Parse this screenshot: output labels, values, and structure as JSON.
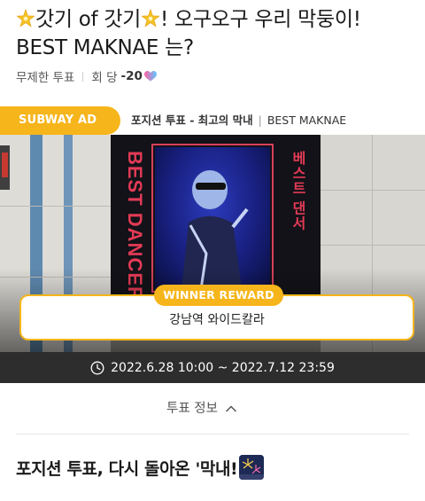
{
  "vote": {
    "title_part1": "갓기 of 갓기",
    "title_part2": "! 오구오구 우리 막둥이! BEST MAKNAE 는?",
    "title_icon": "sparkle-star-icon",
    "vote_type": "무제한 투표",
    "per_vote_label": "회 당",
    "per_vote_value": "-20",
    "heart_icon": "heart-icon"
  },
  "ad": {
    "badge": "SUBWAY AD",
    "caption_bold": "포지션 투표 - 최고의 막내",
    "caption_sep": "|",
    "caption_tail": "BEST MAKNAE",
    "billboard_text_left": "BEST DANCER",
    "billboard_text_right": "베스트 댄서",
    "reward_label": "WINNER REWARD",
    "reward_value": "강남역 와이드칼라",
    "period": "2022.6.28 10:00 ~ 2022.7.12 23:59"
  },
  "info": {
    "toggle_label": "투표 정보",
    "chevron_icon": "chevron-up-icon"
  },
  "section": {
    "heading": "포지션 투표, 다시 돌아온 '막내!",
    "heading_icon": "fireworks-icon"
  },
  "colors": {
    "accent": "#f6b51b",
    "dark_bar": "#2d2d2d",
    "billboard_red": "#e23a55"
  }
}
